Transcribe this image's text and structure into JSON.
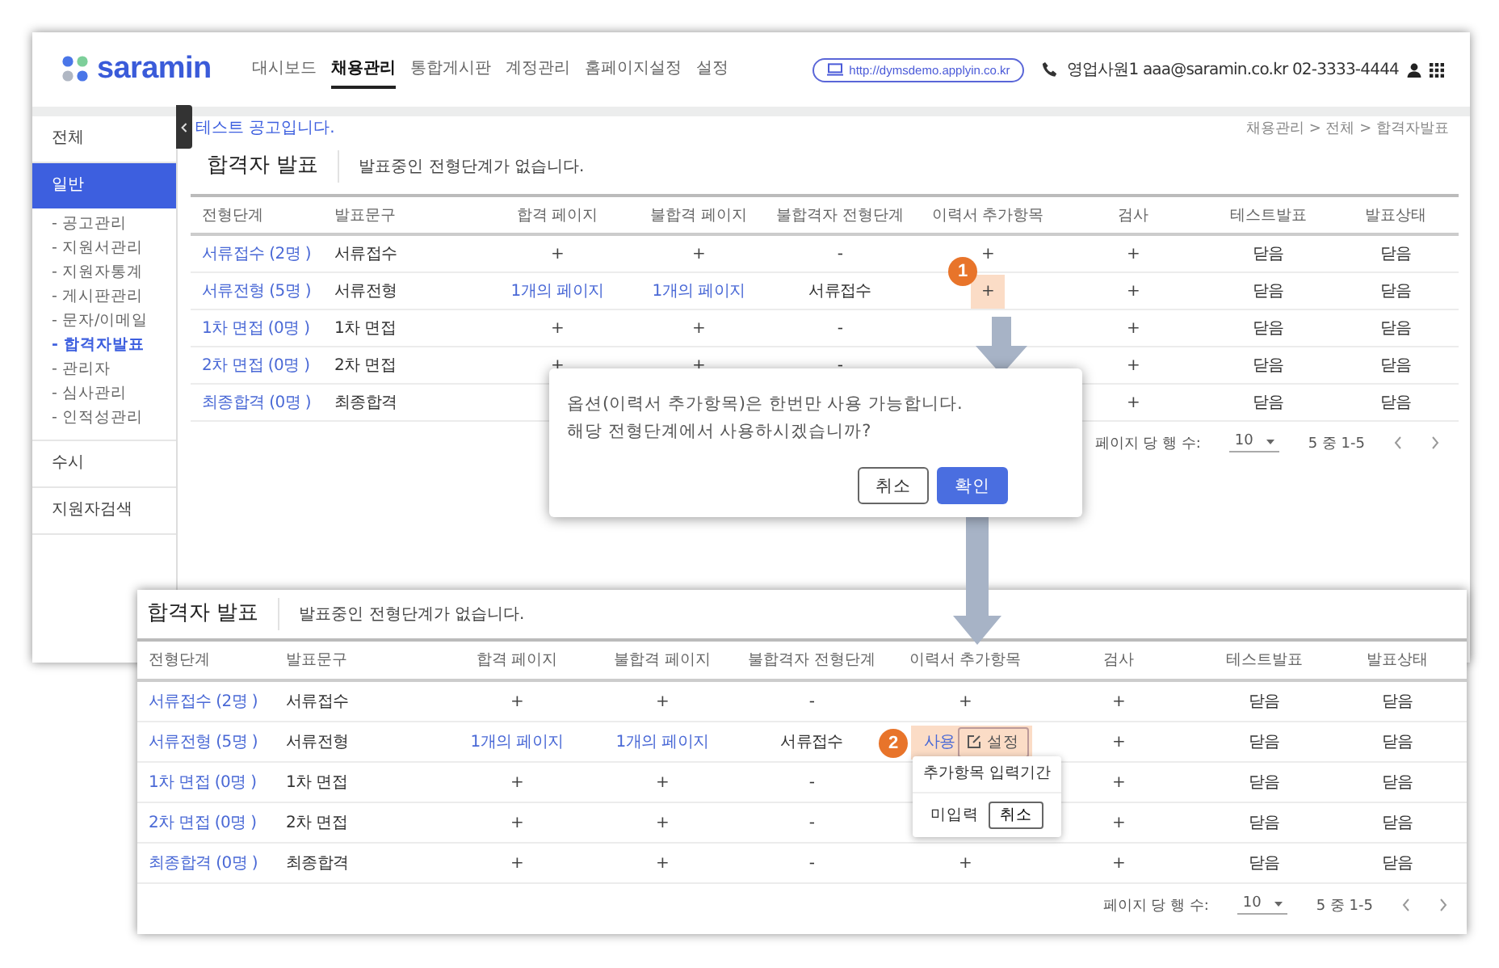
{
  "main_screen": {
    "logo": "saramin",
    "nav": [
      {
        "label": "대시보드",
        "selected": false
      },
      {
        "label": "채용관리",
        "selected": true
      },
      {
        "label": "통합게시판",
        "selected": false
      },
      {
        "label": "계정관리",
        "selected": false
      },
      {
        "label": "홈페이지설정",
        "selected": false
      },
      {
        "label": "설정",
        "selected": false
      }
    ],
    "site_link": "http://dymsdemo.applyin.co.kr",
    "contact": "영업사원1 aaa@saramin.co.kr 02-3333-4444",
    "sidebar": {
      "items": [
        {
          "label": "전체",
          "selected": false
        },
        {
          "label": "일반",
          "selected": true,
          "children": [
            {
              "label": "- 공고관리",
              "selected": false
            },
            {
              "label": "- 지원서관리",
              "selected": false
            },
            {
              "label": "- 지원자통계",
              "selected": false
            },
            {
              "label": "- 게시판관리",
              "selected": false
            },
            {
              "label": "- 문자/이메일",
              "selected": false
            },
            {
              "label": "- 합격자발표",
              "selected": true
            },
            {
              "label": "- 관리자",
              "selected": false
            },
            {
              "label": "- 심사관리",
              "selected": false
            },
            {
              "label": "- 인적성관리",
              "selected": false
            }
          ]
        },
        {
          "label": "수시",
          "selected": false
        },
        {
          "label": "지원자검색",
          "selected": false
        }
      ]
    },
    "notice": "테스트 공고입니다.",
    "breadcrumb": "채용관리 > 전체 > 합격자발표",
    "title": "합격자 발표",
    "subtitle": "발표중인 전형단계가 없습니다.",
    "table": {
      "columns": [
        "전형단계",
        "발표문구",
        "합격 페이지",
        "불합격 페이지",
        "불합격자 전형단계",
        "이력서 추가항목",
        "검사",
        "테스트발표",
        "발표상태"
      ],
      "rows": [
        {
          "cells": [
            {
              "text": "서류접수 (2명 )",
              "kind": "stage"
            },
            {
              "text": "서류접수",
              "kind": "plain"
            },
            {
              "text": "+",
              "kind": "action"
            },
            {
              "text": "+",
              "kind": "action"
            },
            {
              "text": "-",
              "kind": "plain"
            },
            {
              "text": "+",
              "kind": "action"
            },
            {
              "text": "+",
              "kind": "action"
            },
            {
              "text": "닫음",
              "kind": "plain"
            },
            {
              "text": "닫음",
              "kind": "plain"
            }
          ]
        },
        {
          "cells": [
            {
              "text": "서류전형 (5명 )",
              "kind": "stage"
            },
            {
              "text": "서류전형",
              "kind": "plain"
            },
            {
              "text": "1개의 페이지",
              "kind": "link"
            },
            {
              "text": "1개의 페이지",
              "kind": "link"
            },
            {
              "text": "서류접수",
              "kind": "plain"
            },
            {
              "text": "+",
              "kind": "action",
              "highlighted": true
            },
            {
              "text": "+",
              "kind": "action"
            },
            {
              "text": "닫음",
              "kind": "plain"
            },
            {
              "text": "닫음",
              "kind": "plain"
            }
          ]
        },
        {
          "cells": [
            {
              "text": "1차 면접 (0명 )",
              "kind": "stage"
            },
            {
              "text": "1차 면접",
              "kind": "plain"
            },
            {
              "text": "+",
              "kind": "action"
            },
            {
              "text": "+",
              "kind": "action"
            },
            {
              "text": "-",
              "kind": "plain"
            },
            null,
            {
              "text": "+",
              "kind": "action"
            },
            {
              "text": "닫음",
              "kind": "plain"
            },
            {
              "text": "닫음",
              "kind": "plain"
            }
          ]
        },
        {
          "cells": [
            {
              "text": "2차 면접 (0명 )",
              "kind": "stage"
            },
            {
              "text": "2차 면접",
              "kind": "plain"
            },
            {
              "text": "+",
              "kind": "action"
            },
            {
              "text": "+",
              "kind": "action"
            },
            {
              "text": "-",
              "kind": "plain"
            },
            null,
            {
              "text": "+",
              "kind": "action"
            },
            {
              "text": "닫음",
              "kind": "plain"
            },
            {
              "text": "닫음",
              "kind": "plain"
            }
          ]
        },
        {
          "cells": [
            {
              "text": "최종합격 (0명 )",
              "kind": "stage"
            },
            {
              "text": "최종합격",
              "kind": "plain"
            },
            null,
            null,
            null,
            null,
            {
              "text": "+",
              "kind": "action"
            },
            {
              "text": "닫음",
              "kind": "plain"
            },
            {
              "text": "닫음",
              "kind": "plain"
            }
          ]
        }
      ]
    },
    "pagination": {
      "rows_label": "페이지 당 행 수:",
      "rows_value": "10",
      "range": "5 중 1-5"
    }
  },
  "confirm_dialog": {
    "message": [
      "옵션(이력서 추가항목)은 한번만 사용 가능합니다.",
      "해당 전형단계에서 사용하시겠습니까?"
    ],
    "buttons": [
      {
        "label": "취소",
        "kind": "secondary"
      },
      {
        "label": "확인",
        "kind": "primary"
      }
    ]
  },
  "detail_screen": {
    "title": "합격자 발표",
    "subtitle": "발표중인 전형단계가 없습니다.",
    "table": {
      "columns": [
        "전형단계",
        "발표문구",
        "합격 페이지",
        "불합격 페이지",
        "불합격자 전형단계",
        "이력서 추가항목",
        "검사",
        "테스트발표",
        "발표상태"
      ],
      "rows": [
        {
          "cells": [
            {
              "text": "서류접수 (2명 )",
              "kind": "stage"
            },
            {
              "text": "서류접수",
              "kind": "plain"
            },
            {
              "text": "+",
              "kind": "action"
            },
            {
              "text": "+",
              "kind": "action"
            },
            {
              "text": "-",
              "kind": "plain"
            },
            {
              "text": "+",
              "kind": "action"
            },
            {
              "text": "+",
              "kind": "action"
            },
            {
              "text": "닫음",
              "kind": "plain"
            },
            {
              "text": "닫음",
              "kind": "plain"
            }
          ]
        },
        {
          "cells": [
            {
              "text": "서류전형 (5명 )",
              "kind": "stage"
            },
            {
              "text": "서류전형",
              "kind": "plain"
            },
            {
              "text": "1개의 페이지",
              "kind": "link"
            },
            {
              "text": "1개의 페이지",
              "kind": "link"
            },
            {
              "text": "서류접수",
              "kind": "plain"
            },
            {
              "text": "사용",
              "kind": "option",
              "button": "설정",
              "highlighted": true
            },
            {
              "text": "+",
              "kind": "action"
            },
            {
              "text": "닫음",
              "kind": "plain"
            },
            {
              "text": "닫음",
              "kind": "plain"
            }
          ]
        },
        {
          "cells": [
            {
              "text": "1차 면접 (0명 )",
              "kind": "stage"
            },
            {
              "text": "1차 면접",
              "kind": "plain"
            },
            {
              "text": "+",
              "kind": "action"
            },
            {
              "text": "+",
              "kind": "action"
            },
            {
              "text": "-",
              "kind": "plain"
            },
            null,
            {
              "text": "+",
              "kind": "action"
            },
            {
              "text": "닫음",
              "kind": "plain"
            },
            {
              "text": "닫음",
              "kind": "plain"
            }
          ]
        },
        {
          "cells": [
            {
              "text": "2차 면접 (0명 )",
              "kind": "stage"
            },
            {
              "text": "2차 면접",
              "kind": "plain"
            },
            {
              "text": "+",
              "kind": "action"
            },
            {
              "text": "+",
              "kind": "action"
            },
            {
              "text": "-",
              "kind": "plain"
            },
            null,
            {
              "text": "+",
              "kind": "action"
            },
            {
              "text": "닫음",
              "kind": "plain"
            },
            {
              "text": "닫음",
              "kind": "plain"
            }
          ]
        },
        {
          "cells": [
            {
              "text": "최종합격 (0명 )",
              "kind": "stage"
            },
            {
              "text": "최종합격",
              "kind": "plain"
            },
            {
              "text": "+",
              "kind": "action"
            },
            {
              "text": "+",
              "kind": "action"
            },
            {
              "text": "-",
              "kind": "plain"
            },
            {
              "text": "+",
              "kind": "action"
            },
            {
              "text": "+",
              "kind": "action"
            },
            {
              "text": "닫음",
              "kind": "plain"
            },
            {
              "text": "닫음",
              "kind": "plain"
            }
          ]
        }
      ]
    },
    "popup": {
      "title": "추가항목 입력기간",
      "status": "미입력",
      "button": "취소"
    },
    "pagination": {
      "rows_label": "페이지 당 행 수:",
      "rows_value": "10",
      "range": "5 중 1-5"
    }
  },
  "markers": [
    {
      "label": "1"
    },
    {
      "label": "2"
    }
  ]
}
